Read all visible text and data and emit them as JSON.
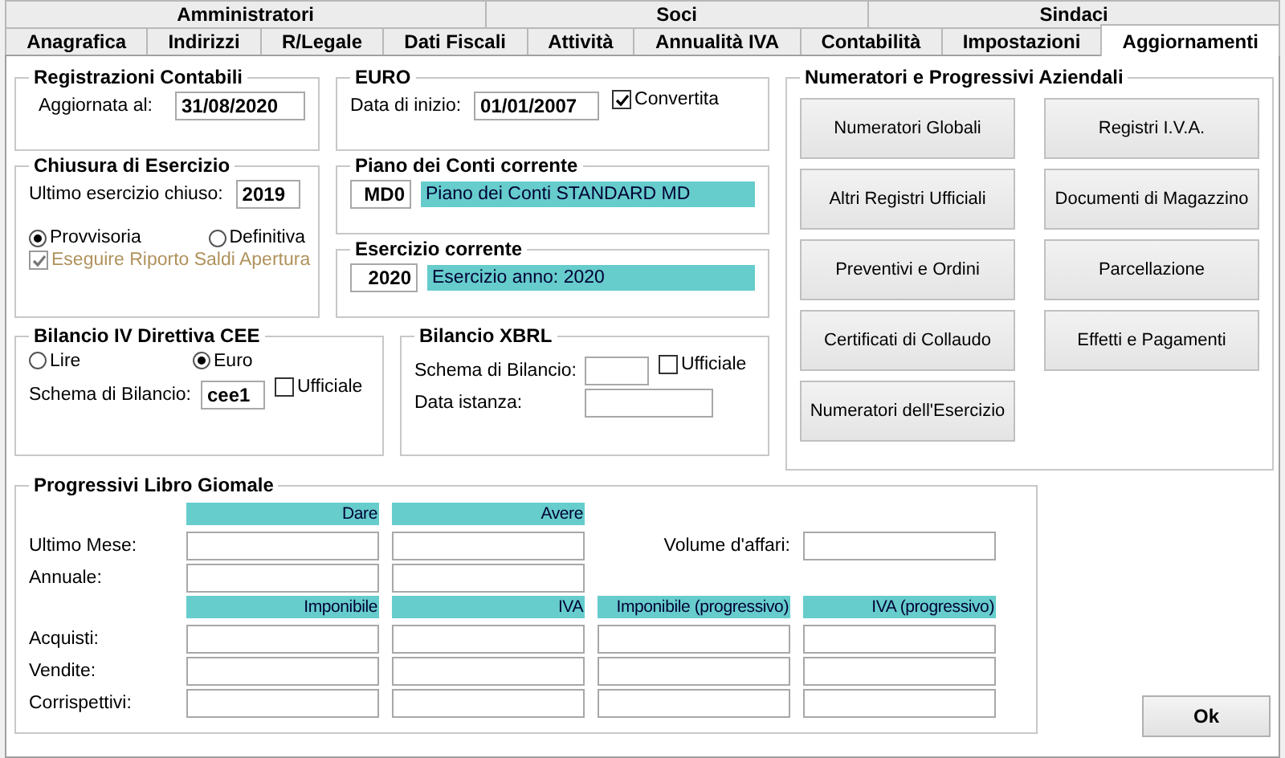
{
  "tabs_row1": [
    {
      "label": "Amministratori",
      "selected": false
    },
    {
      "label": "Soci",
      "selected": false
    },
    {
      "label": "Sindaci",
      "selected": false
    }
  ],
  "tabs_row2": [
    {
      "label": "Anagrafica",
      "selected": false
    },
    {
      "label": "Indirizzi",
      "selected": false
    },
    {
      "label": "R/Legale",
      "selected": false
    },
    {
      "label": "Dati Fiscali",
      "selected": false
    },
    {
      "label": "Attività",
      "selected": false
    },
    {
      "label": "Annualità IVA",
      "selected": false
    },
    {
      "label": "Contabilità",
      "selected": false
    },
    {
      "label": "Impostazioni",
      "selected": false
    },
    {
      "label": "Aggiornamenti",
      "selected": true
    }
  ],
  "registrazioni": {
    "title": "Registrazioni Contabili",
    "label": "Aggiornata al:",
    "value": "31/08/2020"
  },
  "euro": {
    "title": "EURO",
    "label": "Data di inizio:",
    "value": "01/01/2007",
    "convertita": {
      "label": "Convertita",
      "checked": true
    }
  },
  "chiusura": {
    "title": "Chiusura di Esercizio",
    "label": "Ultimo esercizio chiuso:",
    "value": "2019",
    "options": [
      {
        "label": "Provvisoria",
        "selected": true
      },
      {
        "label": "Definitiva",
        "selected": false
      }
    ],
    "riporto": {
      "label": "Eseguire Riporto Saldi Apertura",
      "checked": true,
      "disabled": true
    }
  },
  "piano": {
    "title": "Piano dei Conti corrente",
    "code": "MD0",
    "description": "Piano dei Conti STANDARD MD"
  },
  "esercizio": {
    "title": "Esercizio corrente",
    "code": "2020",
    "description": "Esercizio anno: 2020"
  },
  "bilancio_cee": {
    "title": "Bilancio IV Direttiva CEE",
    "options": [
      {
        "label": "Lire",
        "selected": false
      },
      {
        "label": "Euro",
        "selected": true
      }
    ],
    "schema_label": "Schema di Bilancio:",
    "schema_value": "cee1",
    "ufficiale": {
      "label": "Ufficiale",
      "checked": false
    }
  },
  "xbrl": {
    "title": "Bilancio XBRL",
    "schema_label": "Schema di Bilancio:",
    "ufficiale": {
      "label": "Ufficiale",
      "checked": false
    },
    "data_label": "Data istanza:"
  },
  "numeratori": {
    "title": "Numeratori e Progressivi Aziendali",
    "buttons": [
      "Numeratori Globali",
      "Registri I.V.A.",
      "Altri Registri Ufficiali",
      "Documenti di Magazzino",
      "Preventivi e Ordini",
      "Parcellazione",
      "Certificati di Collaudo",
      "Effetti e Pagamenti",
      "Numeratori dell'Esercizio"
    ]
  },
  "progressivi": {
    "title": "Progressivi Libro Giomale",
    "headers1": [
      "Dare",
      "Avere"
    ],
    "rows1": [
      "Ultimo Mese:",
      "Annuale:"
    ],
    "volume_label": "Volume d'affari:",
    "headers2": [
      "Imponibile",
      "IVA",
      "Imponibile (progressivo)",
      "IVA (progressivo)"
    ],
    "rows2": [
      "Acquisti:",
      "Vendite:",
      "Corrispettivi:"
    ]
  },
  "ok_button": "Ok"
}
